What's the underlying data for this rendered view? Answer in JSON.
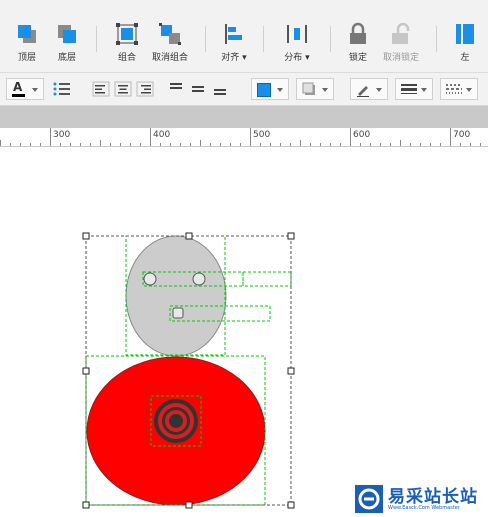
{
  "toolbar": {
    "bring_front": "顶层",
    "send_back": "底层",
    "group": "组合",
    "ungroup": "取消组合",
    "align": "对齐 ▾",
    "distribute": "分布 ▾",
    "lock": "锁定",
    "unlock": "取消锁定",
    "left": "左"
  },
  "format_bar": {
    "font_color_letter": "A",
    "font_color": "#000000",
    "fill_color": "#1b8ee6",
    "line_color": "#666666"
  },
  "ruler": {
    "marks": [
      "300",
      "400",
      "500",
      "600",
      "700"
    ]
  },
  "canvas": {
    "head_color": "#cccccc",
    "body_color": "#ff0000",
    "target_colors": [
      "#d52020",
      "#333333"
    ],
    "selection_color": "#00cc00"
  },
  "watermark": {
    "title": "易采站长站",
    "subtitle": "Www.Easck.Com  Webmaster"
  }
}
